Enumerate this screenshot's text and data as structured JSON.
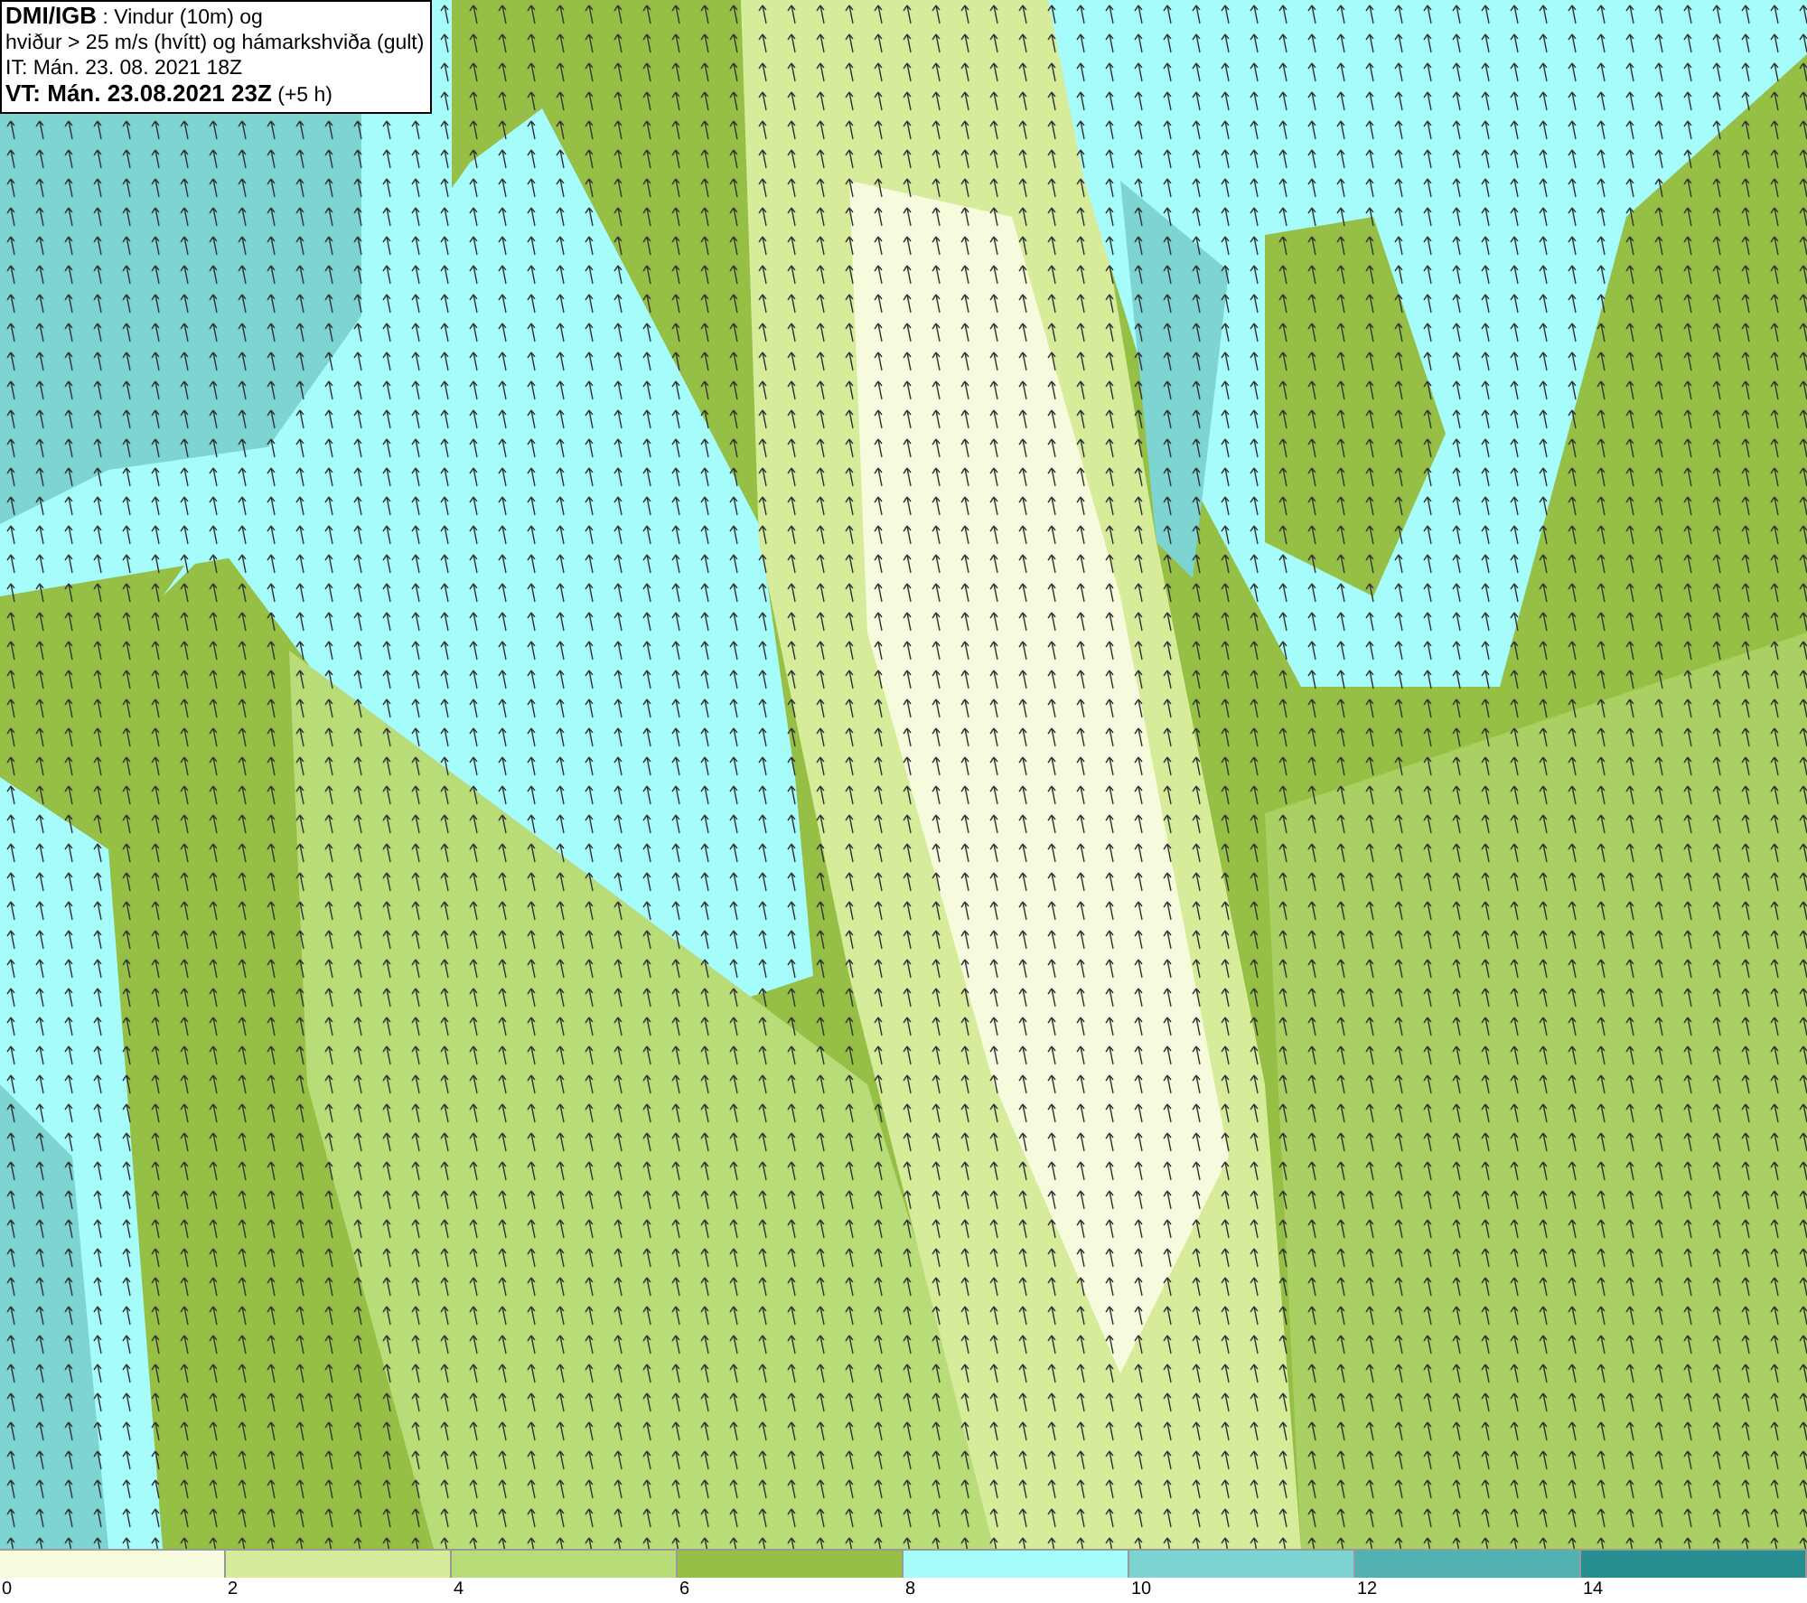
{
  "header": {
    "lines": [
      "**DMI/IGB** : Vindur (10m) og",
      "hviður > 25 m/s (hvítt) og hámarkshviða (gult)",
      "IT: Mán. 23. 08. 2021 18Z",
      "**VT: Mán. 23.08.2021 23Z** (+5 h)"
    ]
  },
  "legend": {
    "bins": [
      {
        "color": "#f5fbdc"
      },
      {
        "color": "#d6ec9a"
      },
      {
        "color": "#b8dc78"
      },
      {
        "color": "#96bf46"
      },
      {
        "color": "#a6fbfb"
      },
      {
        "color": "#7ed3d3"
      },
      {
        "color": "#52b2b2"
      },
      {
        "color": "#278f8f"
      }
    ],
    "ticks": [
      "0",
      "2",
      "4",
      "6",
      "8",
      "10",
      "12",
      "14"
    ]
  }
}
